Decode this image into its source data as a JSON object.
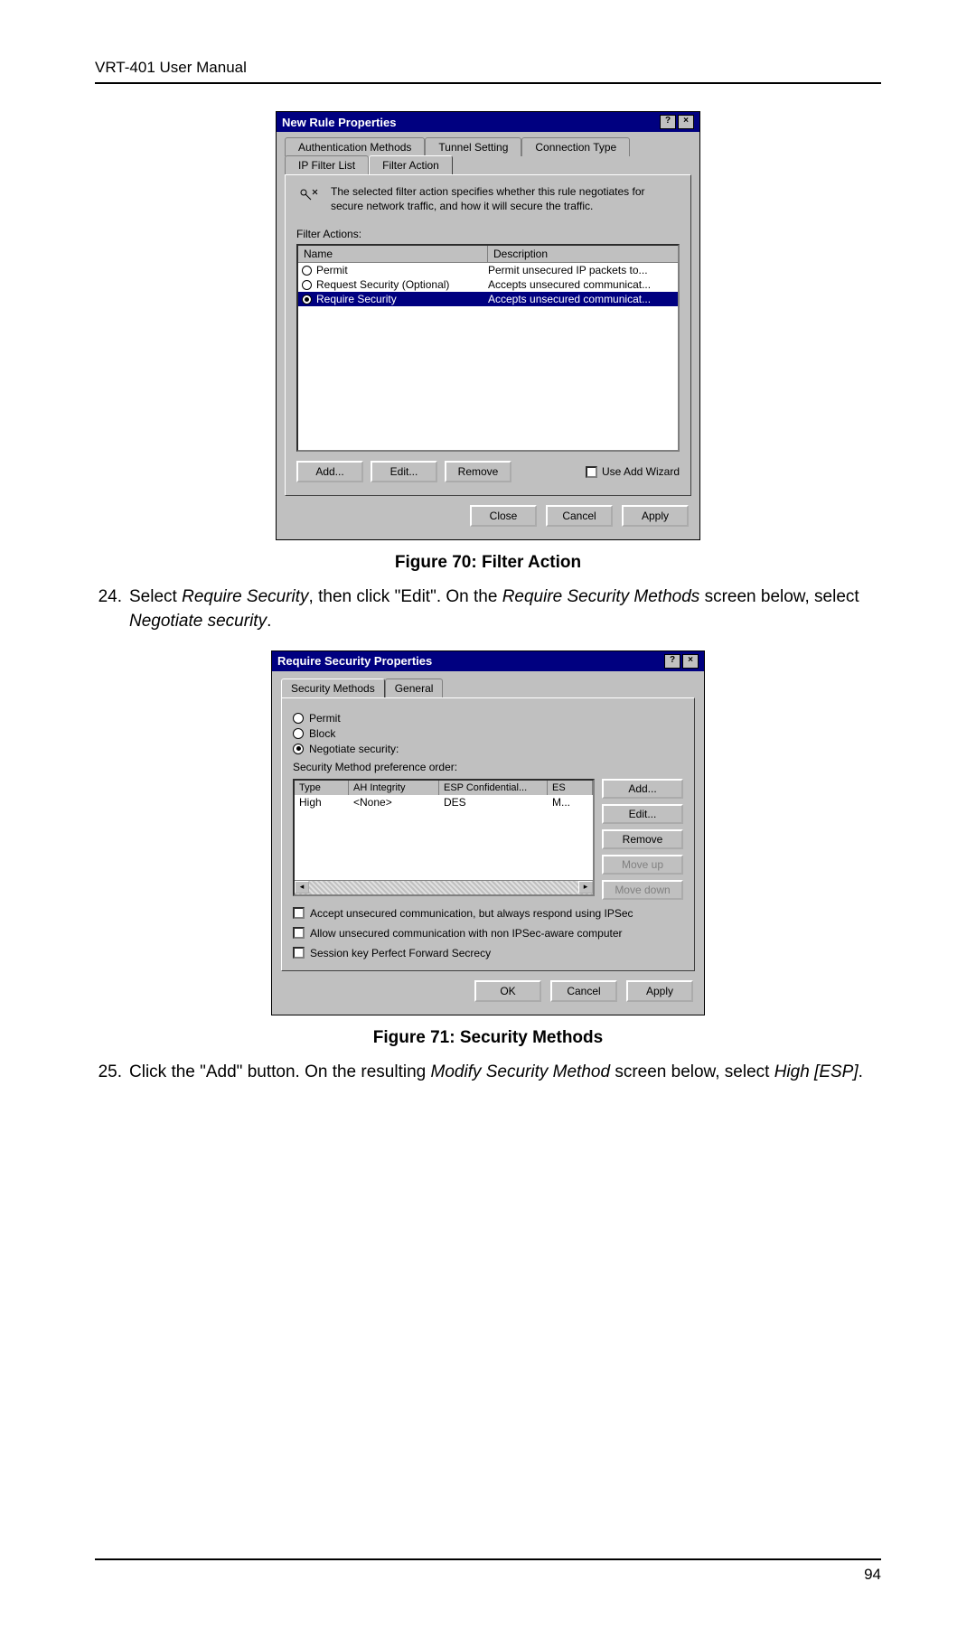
{
  "header": "VRT-401 User Manual",
  "page_number": "94",
  "figure70": {
    "caption": "Figure 70: Filter Action",
    "dialog": {
      "title": "New Rule Properties",
      "tabs_row1": [
        "Authentication Methods",
        "Tunnel Setting",
        "Connection Type"
      ],
      "tabs_row2": [
        "IP Filter List",
        "Filter Action"
      ],
      "hint": "The selected filter action specifies whether this rule negotiates for secure network traffic, and how it will secure the traffic.",
      "filter_actions_label": "Filter Actions:",
      "columns": {
        "name": "Name",
        "desc": "Description"
      },
      "rows": [
        {
          "name": "Permit",
          "desc": "Permit unsecured IP packets to...",
          "selected": false
        },
        {
          "name": "Request Security (Optional)",
          "desc": "Accepts unsecured communicat...",
          "selected": false
        },
        {
          "name": "Require Security",
          "desc": "Accepts unsecured communicat...",
          "selected": true
        }
      ],
      "buttons": {
        "add": "Add...",
        "edit": "Edit...",
        "remove": "Remove"
      },
      "use_wizard": "Use Add Wizard",
      "footer": {
        "close": "Close",
        "cancel": "Cancel",
        "apply": "Apply"
      }
    }
  },
  "instruction24": {
    "num": "24.",
    "text_before": "Select ",
    "em1": "Require Security",
    "text_mid1": ", then click \"Edit\". On the ",
    "em2": "Require Security Methods",
    "text_mid2": " screen below, select ",
    "em3": "Negotiate security",
    "text_after": "."
  },
  "figure71": {
    "caption": "Figure 71: Security Methods",
    "dialog": {
      "title": "Require Security Properties",
      "tabs": [
        "Security Methods",
        "General"
      ],
      "radios": {
        "permit": "Permit",
        "block": "Block",
        "negotiate": "Negotiate security:"
      },
      "pref_label": "Security Method preference order:",
      "table": {
        "headers": {
          "type": "Type",
          "ah": "AH Integrity",
          "esp_conf": "ESP Confidential...",
          "es": "ES"
        },
        "row": {
          "type": "High",
          "ah": "<None>",
          "esp": "DES",
          "es": "M..."
        }
      },
      "side_buttons": {
        "add": "Add...",
        "edit": "Edit...",
        "remove": "Remove",
        "moveup": "Move up",
        "movedown": "Move down"
      },
      "checks": {
        "c1": "Accept unsecured communication, but always respond using IPSec",
        "c2": "Allow unsecured communication with non IPSec-aware computer",
        "c3": "Session key Perfect Forward Secrecy"
      },
      "footer": {
        "ok": "OK",
        "cancel": "Cancel",
        "apply": "Apply"
      }
    }
  },
  "instruction25": {
    "num": "25.",
    "text_before": "Click the \"Add\" button. On the resulting ",
    "em1": "Modify Security Method",
    "text_mid1": " screen below, select ",
    "em2": "High [ESP]",
    "text_after": "."
  }
}
